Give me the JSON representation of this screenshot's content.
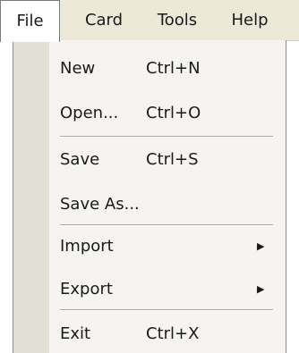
{
  "menubar": {
    "items": [
      {
        "label": "File",
        "open": true
      },
      {
        "label": "Card"
      },
      {
        "label": "Tools"
      },
      {
        "label": "Help"
      }
    ]
  },
  "dropdown": {
    "items": [
      {
        "label": "New",
        "shortcut": "Ctrl+N"
      },
      {
        "label": "Open...",
        "shortcut": "Ctrl+O"
      },
      {
        "label": "Save",
        "shortcut": "Ctrl+S"
      },
      {
        "label": "Save As...",
        "shortcut": ""
      },
      {
        "label": "Import",
        "submenu_arrow": "▶"
      },
      {
        "label": "Export",
        "submenu_arrow": "▶"
      },
      {
        "label": "Exit",
        "shortcut": "Ctrl+X"
      }
    ]
  }
}
